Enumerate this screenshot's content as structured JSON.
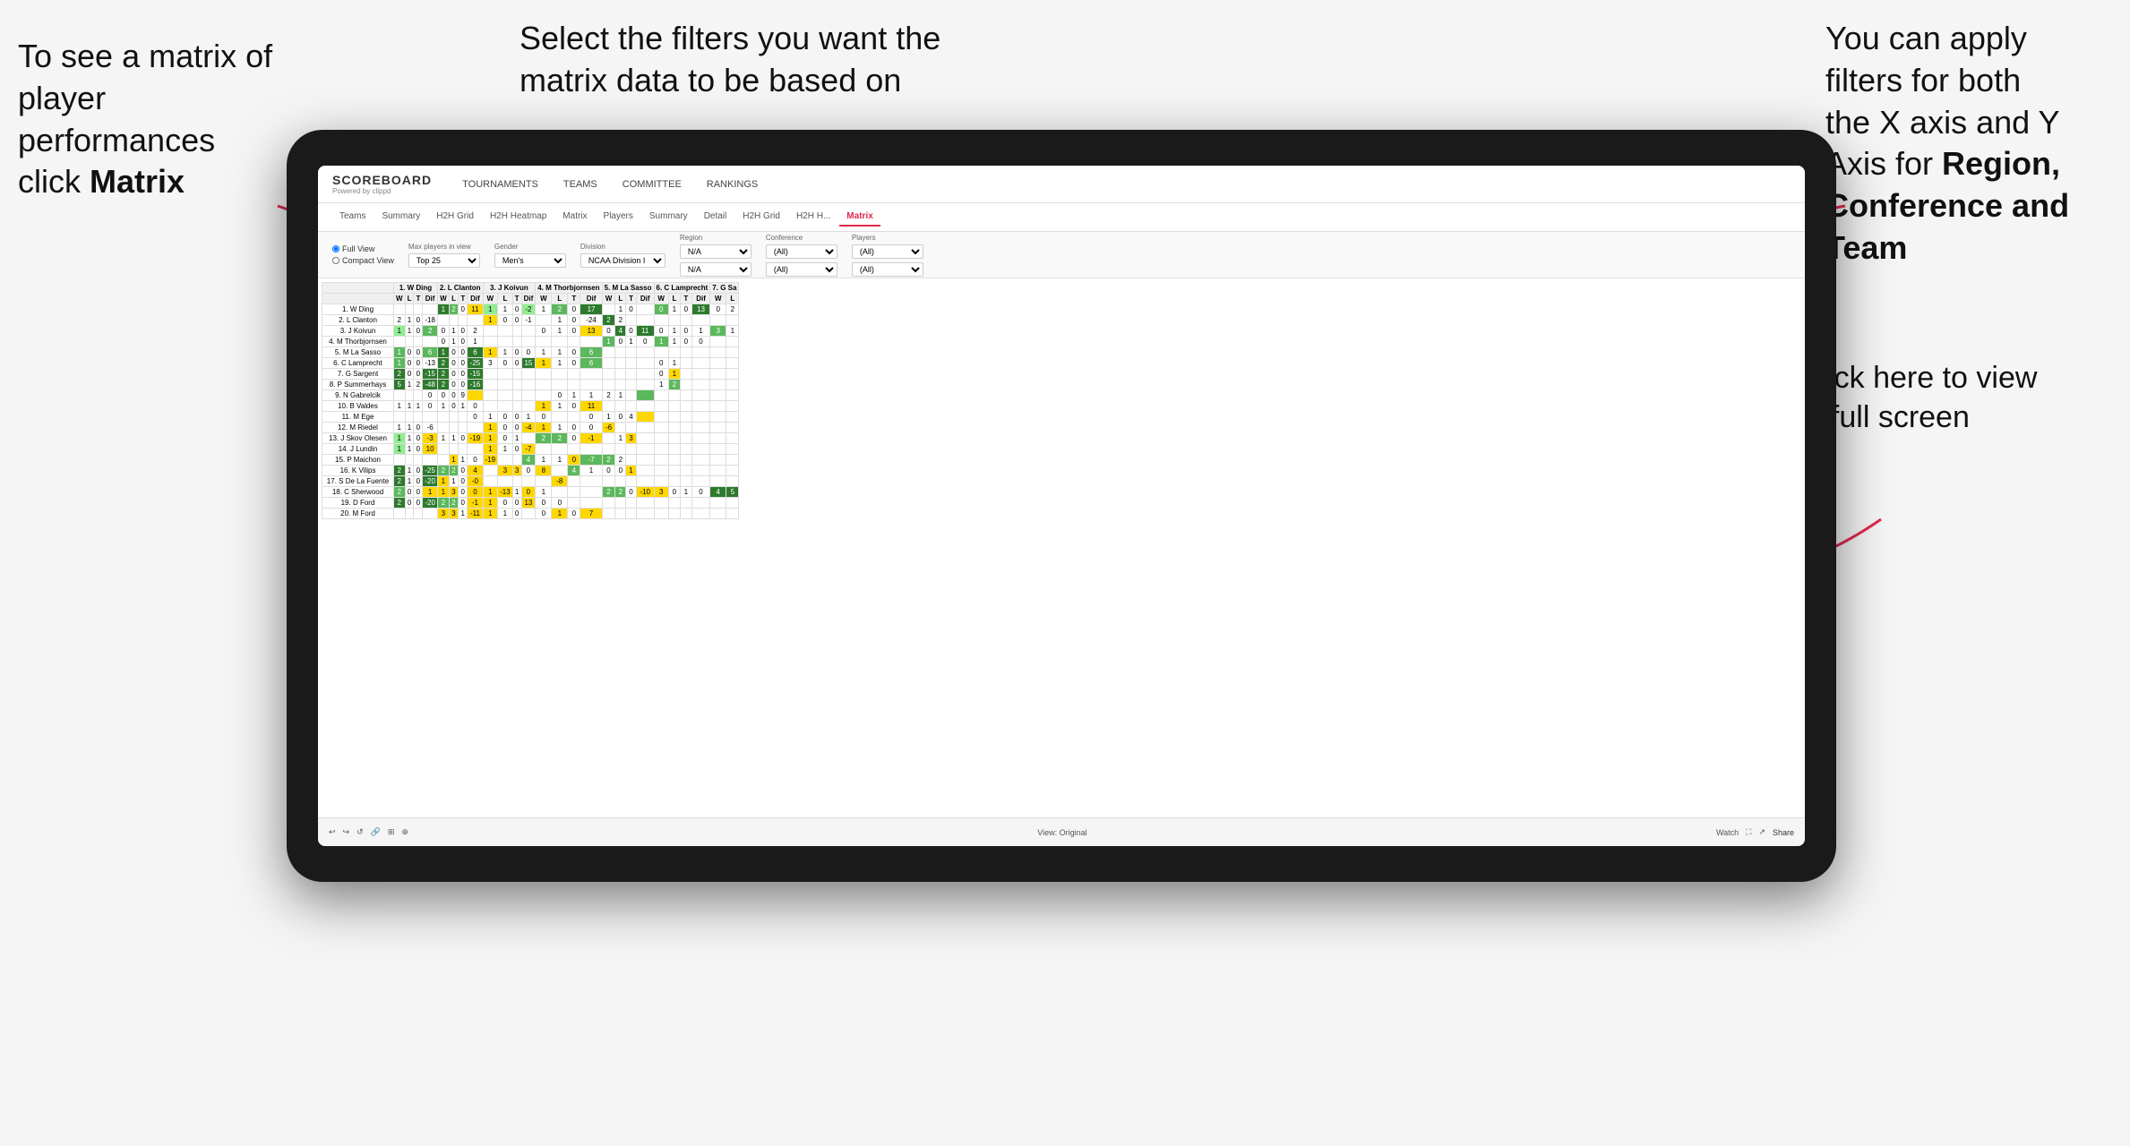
{
  "annotations": {
    "left": {
      "line1": "To see a matrix of",
      "line2": "player performances",
      "line3": "click ",
      "line3_bold": "Matrix"
    },
    "center": {
      "text": "Select the filters you want the matrix data to be based on"
    },
    "right": {
      "line1": "You  can apply",
      "line2": "filters for both",
      "line3": "the X axis and Y",
      "line4_pre": "Axis for ",
      "line4_bold": "Region,",
      "line5_bold": "Conference and",
      "line6_bold": "Team"
    },
    "bottom_right": {
      "line1": "Click here to view",
      "line2": "in full screen"
    }
  },
  "nav": {
    "logo": "SCOREBOARD",
    "logo_sub": "Powered by clippd",
    "items": [
      "TOURNAMENTS",
      "TEAMS",
      "COMMITTEE",
      "RANKINGS"
    ]
  },
  "sub_nav": {
    "items": [
      "Teams",
      "Summary",
      "H2H Grid",
      "H2H Heatmap",
      "Matrix",
      "Players",
      "Summary",
      "Detail",
      "H2H Grid",
      "H2H H...",
      "Matrix"
    ],
    "active_index": 10
  },
  "filters": {
    "view_options": [
      "Full View",
      "Compact View"
    ],
    "max_players": {
      "label": "Max players in view",
      "value": "Top 25"
    },
    "gender": {
      "label": "Gender",
      "value": "Men's"
    },
    "division": {
      "label": "Division",
      "value": "NCAA Division I"
    },
    "region": {
      "label": "Region",
      "values": [
        "N/A",
        "N/A"
      ]
    },
    "conference": {
      "label": "Conference",
      "values": [
        "(All)",
        "(All)"
      ]
    },
    "players": {
      "label": "Players",
      "values": [
        "(All)",
        "(All)"
      ]
    }
  },
  "matrix": {
    "col_headers": [
      "1. W Ding",
      "2. L Clanton",
      "3. J Koivun",
      "4. M Thorbjornsen",
      "5. M La Sasso",
      "6. C Lamprecht",
      "7. G Sa"
    ],
    "sub_headers": [
      "W",
      "L",
      "T",
      "Dif"
    ],
    "rows": [
      {
        "name": "1. W Ding",
        "data": [
          "",
          "",
          "",
          "",
          "1",
          "2",
          "0",
          "11",
          "1",
          "1",
          "0",
          "-2",
          "1",
          "2",
          "0",
          "17",
          "",
          "1",
          "0",
          "",
          "0",
          "1",
          "0",
          "13",
          "0",
          "2"
        ]
      },
      {
        "name": "2. L Clanton",
        "data": [
          "2",
          "1",
          "0",
          "-18",
          "",
          "",
          "",
          "",
          "1",
          "0",
          "0",
          "-1",
          "",
          "1",
          "0",
          "-24",
          "2",
          "2"
        ]
      },
      {
        "name": "3. J Koivun",
        "data": [
          "1",
          "1",
          "0",
          "2",
          "0",
          "1",
          "0",
          "2",
          "",
          "",
          "",
          "",
          "0",
          "1",
          "0",
          "13",
          "0",
          "4",
          "0",
          "11",
          "0",
          "1",
          "0",
          "1",
          "3",
          "1"
        ]
      },
      {
        "name": "4. M Thorbjornsen",
        "data": [
          "",
          "",
          "",
          "",
          "0",
          "1",
          "0",
          "1",
          "",
          "",
          "",
          "",
          "",
          "",
          "",
          "",
          "1",
          "0",
          "1",
          "0",
          "1",
          "1",
          "0",
          "0",
          ""
        ]
      },
      {
        "name": "5. M La Sasso",
        "data": [
          "1",
          "0",
          "0",
          "6",
          "1",
          "0",
          "0",
          "6",
          "1",
          "1",
          "0",
          "0",
          "1",
          "1",
          "0",
          "6",
          "",
          "",
          "",
          "",
          ""
        ]
      },
      {
        "name": "6. C Lamprecht",
        "data": [
          "1",
          "0",
          "0",
          "-13",
          "2",
          "0",
          "0",
          "-25",
          "3",
          "0",
          "0",
          "15",
          "1",
          "1",
          "0",
          "6",
          "",
          "",
          "",
          "",
          "0",
          "1"
        ]
      },
      {
        "name": "7. G Sargent",
        "data": [
          "2",
          "0",
          "0",
          "-15",
          "2",
          "0",
          "0",
          "-15",
          "",
          "",
          "",
          "",
          "",
          "",
          "",
          "",
          "",
          "",
          "",
          "",
          "0",
          "1"
        ]
      },
      {
        "name": "8. P Summerhays",
        "data": [
          "5",
          "1",
          "2",
          "-48",
          "2",
          "0",
          "0",
          "-16",
          "",
          "",
          "",
          "",
          "",
          "",
          "",
          "",
          "",
          "",
          "",
          "",
          "1",
          "2"
        ]
      },
      {
        "name": "9. N Gabrelcik",
        "data": [
          "",
          "",
          "",
          "0",
          "0",
          "0",
          "9",
          "",
          "",
          "",
          "",
          "",
          "",
          "0",
          "1",
          "1",
          "2",
          "1"
        ]
      },
      {
        "name": "10. B Valdes",
        "data": [
          "1",
          "1",
          "1",
          "0",
          "1",
          "0",
          "1",
          "0",
          "",
          "",
          "",
          "",
          "1",
          "1",
          "0",
          "11",
          "",
          "",
          "",
          "",
          ""
        ]
      },
      {
        "name": "11. M Ege",
        "data": [
          "",
          "",
          "",
          "",
          "",
          "",
          "",
          "0",
          "1",
          "0",
          "0",
          "1",
          "0",
          "",
          "",
          "0",
          "1",
          "0",
          "4"
        ]
      },
      {
        "name": "12. M Riedel",
        "data": [
          "1",
          "1",
          "0",
          "-6",
          "",
          "",
          "",
          "",
          "1",
          "0",
          "0",
          "-4",
          "1",
          "1",
          "0",
          "0",
          "-6"
        ]
      },
      {
        "name": "13. J Skov Olesen",
        "data": [
          "1",
          "1",
          "0",
          "-3",
          "1",
          "1",
          "0",
          "-19",
          "1",
          "0",
          "1",
          "",
          "2",
          "2",
          "0",
          "-1",
          "",
          "1",
          "3"
        ]
      },
      {
        "name": "14. J Lundin",
        "data": [
          "1",
          "1",
          "0",
          "10",
          "",
          "",
          "",
          "",
          "1",
          "1",
          "0",
          "-7"
        ]
      },
      {
        "name": "15. P Maichon",
        "data": [
          "",
          "",
          "",
          "",
          "",
          "1",
          "1",
          "0",
          "-19",
          "",
          "",
          "4",
          "1",
          "1",
          "0",
          "-7",
          "2",
          "2"
        ]
      },
      {
        "name": "16. K Vilips",
        "data": [
          "2",
          "1",
          "0",
          "-25",
          "2",
          "2",
          "0",
          "4",
          "",
          "3",
          "3",
          "0",
          "8",
          "",
          "4",
          "1",
          "0",
          "0",
          "1"
        ]
      },
      {
        "name": "17. S De La Fuente",
        "data": [
          "2",
          "1",
          "0",
          "-20",
          "1",
          "1",
          "0",
          "-0",
          "",
          "",
          "",
          "",
          "",
          "-8"
        ]
      },
      {
        "name": "18. C Sherwood",
        "data": [
          "2",
          "0",
          "0",
          "1",
          "1",
          "3",
          "0",
          "0",
          "1",
          "-13",
          "1",
          "0",
          "1",
          "",
          "",
          "",
          "2",
          "2",
          "0",
          "-10",
          "3",
          "0",
          "1",
          "0",
          "4",
          "5"
        ]
      },
      {
        "name": "19. D Ford",
        "data": [
          "2",
          "0",
          "0",
          "-20",
          "2",
          "2",
          "0",
          "-1",
          "1",
          "0",
          "0",
          "13",
          "0",
          "0",
          ""
        ]
      },
      {
        "name": "20. M Ford",
        "data": [
          "",
          "",
          "",
          "",
          "3",
          "3",
          "1",
          "-11",
          "1",
          "1",
          "0",
          "",
          "0",
          "1",
          "0",
          "7"
        ]
      }
    ]
  },
  "bottom_bar": {
    "view_label": "View: Original",
    "watch_label": "Watch",
    "share_label": "Share"
  },
  "colors": {
    "accent": "#e0294e",
    "nav_bg": "#fff",
    "green_dark": "#276b27",
    "green_mid": "#5cb85c",
    "yellow": "#ffd700",
    "orange": "#ff9900"
  }
}
